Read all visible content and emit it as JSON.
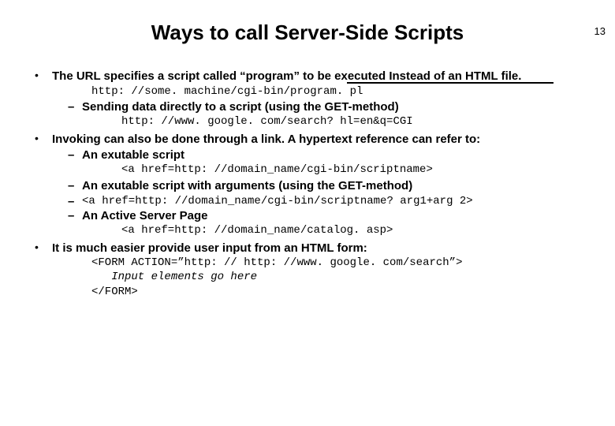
{
  "page_number": "13",
  "title": "Ways to call Server-Side Scripts",
  "bullets": [
    {
      "text": "The URL specifies a script called “program” to be executed Instead of an HTML file.",
      "code1": "http: //some. machine/cgi-bin/program. pl",
      "sub": [
        {
          "text": "Sending data directly to a script (using the GET-method)",
          "code": "http: //www. google. com/search? hl=en&q=CGI"
        }
      ]
    },
    {
      "text": "Invoking can also be done through a link. A hypertext reference can refer to:",
      "sub": [
        {
          "text": "An exutable script",
          "code": "<a href=http: //domain_name/cgi-bin/scriptname>"
        },
        {
          "text": "An exutable script with arguments (using the GET-method)",
          "dashcode": "<a href=http: //domain_name/cgi-bin/scriptname? arg1+arg 2>"
        },
        {
          "text": "An Active Server Page",
          "code": "<a href=http: //domain_name/catalog. asp>"
        }
      ]
    },
    {
      "text": "It is much easier provide user input from an HTML form:",
      "formcode": {
        "line1": "<FORM ACTION=”http: // http: //www. google. com/search”>",
        "line2": "   Input elements go here",
        "line3": "</FORM>"
      }
    }
  ]
}
